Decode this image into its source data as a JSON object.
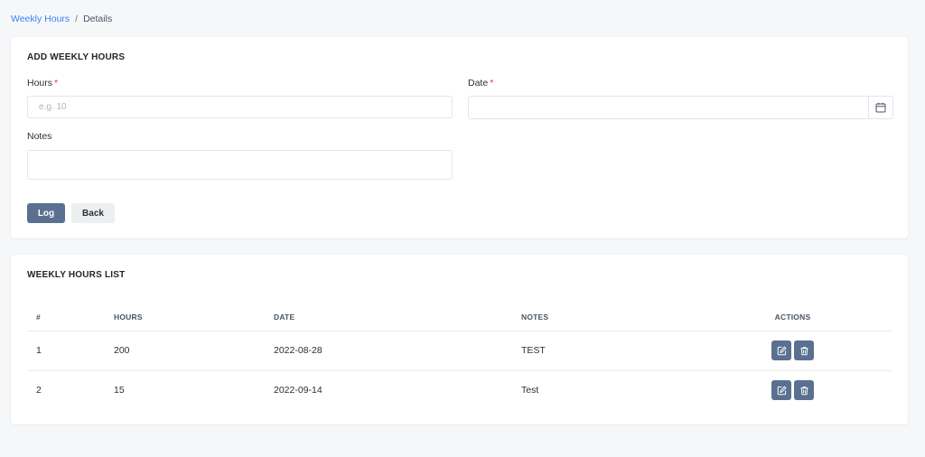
{
  "breadcrumb": {
    "parent": "Weekly Hours",
    "separator": "/",
    "current": "Details"
  },
  "add_form": {
    "title": "ADD WEEKLY HOURS",
    "hours_label": "Hours",
    "hours_placeholder": "e.g. 10",
    "hours_value": "",
    "date_label": "Date",
    "date_value": "",
    "required_mark": "*",
    "notes_label": "Notes",
    "notes_value": "",
    "log_button": "Log",
    "back_button": "Back"
  },
  "list": {
    "title": "WEEKLY HOURS LIST",
    "columns": [
      "#",
      "HOURS",
      "DATE",
      "NOTES",
      "ACTIONS"
    ],
    "rows": [
      {
        "index": "1",
        "hours": "200",
        "date": "2022-08-28",
        "notes": "TEST"
      },
      {
        "index": "2",
        "hours": "15",
        "date": "2022-09-14",
        "notes": "Test"
      }
    ]
  },
  "icons": {
    "calendar": "calendar-icon",
    "edit": "edit-icon",
    "delete": "trash-icon"
  },
  "colors": {
    "link": "#3b82f6",
    "primary": "#5a7090",
    "required": "#e53935",
    "background": "#f6f7f9"
  }
}
